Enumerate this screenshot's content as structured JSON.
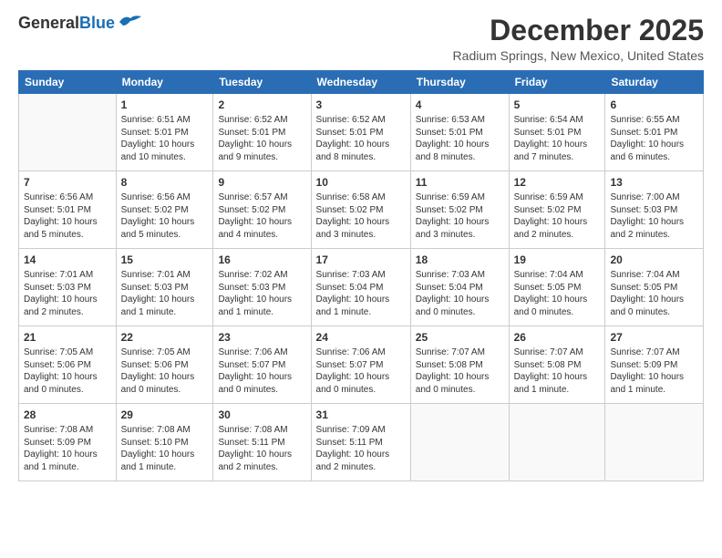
{
  "logo": {
    "general": "General",
    "blue": "Blue"
  },
  "title": "December 2025",
  "location": "Radium Springs, New Mexico, United States",
  "days_header": [
    "Sunday",
    "Monday",
    "Tuesday",
    "Wednesday",
    "Thursday",
    "Friday",
    "Saturday"
  ],
  "weeks": [
    [
      {
        "day": "",
        "empty": true
      },
      {
        "day": "1",
        "sunrise": "6:51 AM",
        "sunset": "5:01 PM",
        "daylight": "10 hours and 10 minutes."
      },
      {
        "day": "2",
        "sunrise": "6:52 AM",
        "sunset": "5:01 PM",
        "daylight": "10 hours and 9 minutes."
      },
      {
        "day": "3",
        "sunrise": "6:52 AM",
        "sunset": "5:01 PM",
        "daylight": "10 hours and 8 minutes."
      },
      {
        "day": "4",
        "sunrise": "6:53 AM",
        "sunset": "5:01 PM",
        "daylight": "10 hours and 8 minutes."
      },
      {
        "day": "5",
        "sunrise": "6:54 AM",
        "sunset": "5:01 PM",
        "daylight": "10 hours and 7 minutes."
      },
      {
        "day": "6",
        "sunrise": "6:55 AM",
        "sunset": "5:01 PM",
        "daylight": "10 hours and 6 minutes."
      }
    ],
    [
      {
        "day": "7",
        "sunrise": "6:56 AM",
        "sunset": "5:01 PM",
        "daylight": "10 hours and 5 minutes."
      },
      {
        "day": "8",
        "sunrise": "6:56 AM",
        "sunset": "5:02 PM",
        "daylight": "10 hours and 5 minutes."
      },
      {
        "day": "9",
        "sunrise": "6:57 AM",
        "sunset": "5:02 PM",
        "daylight": "10 hours and 4 minutes."
      },
      {
        "day": "10",
        "sunrise": "6:58 AM",
        "sunset": "5:02 PM",
        "daylight": "10 hours and 3 minutes."
      },
      {
        "day": "11",
        "sunrise": "6:59 AM",
        "sunset": "5:02 PM",
        "daylight": "10 hours and 3 minutes."
      },
      {
        "day": "12",
        "sunrise": "6:59 AM",
        "sunset": "5:02 PM",
        "daylight": "10 hours and 2 minutes."
      },
      {
        "day": "13",
        "sunrise": "7:00 AM",
        "sunset": "5:03 PM",
        "daylight": "10 hours and 2 minutes."
      }
    ],
    [
      {
        "day": "14",
        "sunrise": "7:01 AM",
        "sunset": "5:03 PM",
        "daylight": "10 hours and 2 minutes."
      },
      {
        "day": "15",
        "sunrise": "7:01 AM",
        "sunset": "5:03 PM",
        "daylight": "10 hours and 1 minute."
      },
      {
        "day": "16",
        "sunrise": "7:02 AM",
        "sunset": "5:03 PM",
        "daylight": "10 hours and 1 minute."
      },
      {
        "day": "17",
        "sunrise": "7:03 AM",
        "sunset": "5:04 PM",
        "daylight": "10 hours and 1 minute."
      },
      {
        "day": "18",
        "sunrise": "7:03 AM",
        "sunset": "5:04 PM",
        "daylight": "10 hours and 0 minutes."
      },
      {
        "day": "19",
        "sunrise": "7:04 AM",
        "sunset": "5:05 PM",
        "daylight": "10 hours and 0 minutes."
      },
      {
        "day": "20",
        "sunrise": "7:04 AM",
        "sunset": "5:05 PM",
        "daylight": "10 hours and 0 minutes."
      }
    ],
    [
      {
        "day": "21",
        "sunrise": "7:05 AM",
        "sunset": "5:06 PM",
        "daylight": "10 hours and 0 minutes."
      },
      {
        "day": "22",
        "sunrise": "7:05 AM",
        "sunset": "5:06 PM",
        "daylight": "10 hours and 0 minutes."
      },
      {
        "day": "23",
        "sunrise": "7:06 AM",
        "sunset": "5:07 PM",
        "daylight": "10 hours and 0 minutes."
      },
      {
        "day": "24",
        "sunrise": "7:06 AM",
        "sunset": "5:07 PM",
        "daylight": "10 hours and 0 minutes."
      },
      {
        "day": "25",
        "sunrise": "7:07 AM",
        "sunset": "5:08 PM",
        "daylight": "10 hours and 0 minutes."
      },
      {
        "day": "26",
        "sunrise": "7:07 AM",
        "sunset": "5:08 PM",
        "daylight": "10 hours and 1 minute."
      },
      {
        "day": "27",
        "sunrise": "7:07 AM",
        "sunset": "5:09 PM",
        "daylight": "10 hours and 1 minute."
      }
    ],
    [
      {
        "day": "28",
        "sunrise": "7:08 AM",
        "sunset": "5:09 PM",
        "daylight": "10 hours and 1 minute."
      },
      {
        "day": "29",
        "sunrise": "7:08 AM",
        "sunset": "5:10 PM",
        "daylight": "10 hours and 1 minute."
      },
      {
        "day": "30",
        "sunrise": "7:08 AM",
        "sunset": "5:11 PM",
        "daylight": "10 hours and 2 minutes."
      },
      {
        "day": "31",
        "sunrise": "7:09 AM",
        "sunset": "5:11 PM",
        "daylight": "10 hours and 2 minutes."
      },
      {
        "day": "",
        "empty": true
      },
      {
        "day": "",
        "empty": true
      },
      {
        "day": "",
        "empty": true
      }
    ]
  ]
}
